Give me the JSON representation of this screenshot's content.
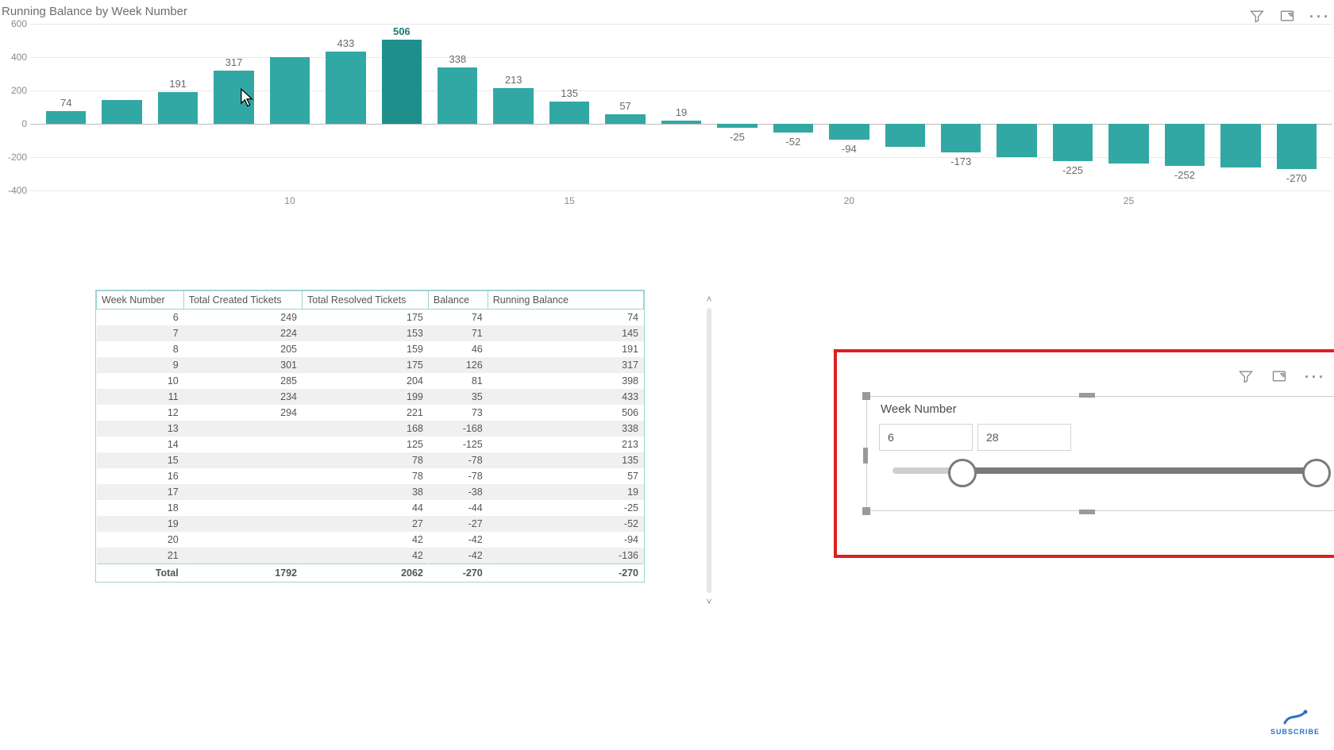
{
  "chart_data": {
    "type": "bar",
    "title": "Running Balance by Week Number",
    "xlabel": "",
    "ylabel": "",
    "ylim": [
      -400,
      600
    ],
    "y_ticks": [
      -400,
      -200,
      0,
      200,
      400,
      600
    ],
    "x_ticks": [
      10,
      15,
      20,
      25
    ],
    "highlight_index": 6,
    "categories": [
      6,
      7,
      8,
      9,
      10,
      11,
      12,
      13,
      14,
      15,
      16,
      17,
      18,
      19,
      20,
      21,
      22,
      23,
      24,
      25,
      26,
      27,
      28
    ],
    "values": [
      74,
      145,
      191,
      317,
      398,
      433,
      506,
      338,
      213,
      135,
      57,
      19,
      -25,
      -52,
      -94,
      -136,
      -173,
      -198,
      -225,
      -238,
      -252,
      -261,
      -270
    ],
    "data_labels": [
      74,
      null,
      191,
      317,
      null,
      433,
      506,
      338,
      213,
      135,
      57,
      19,
      -25,
      -52,
      -94,
      null,
      -173,
      null,
      -225,
      null,
      -252,
      null,
      -270
    ]
  },
  "table": {
    "headers": [
      "Week Number",
      "Total Created Tickets",
      "Total Resolved Tickets",
      "Balance",
      "Running Balance"
    ],
    "rows": [
      [
        6,
        249,
        175,
        74,
        74
      ],
      [
        7,
        224,
        153,
        71,
        145
      ],
      [
        8,
        205,
        159,
        46,
        191
      ],
      [
        9,
        301,
        175,
        126,
        317
      ],
      [
        10,
        285,
        204,
        81,
        398
      ],
      [
        11,
        234,
        199,
        35,
        433
      ],
      [
        12,
        294,
        221,
        73,
        506
      ],
      [
        13,
        null,
        168,
        -168,
        338
      ],
      [
        14,
        null,
        125,
        -125,
        213
      ],
      [
        15,
        null,
        78,
        -78,
        135
      ],
      [
        16,
        null,
        78,
        -78,
        57
      ],
      [
        17,
        null,
        38,
        -38,
        19
      ],
      [
        18,
        null,
        44,
        -44,
        -25
      ],
      [
        19,
        null,
        27,
        -27,
        -52
      ],
      [
        20,
        null,
        42,
        -42,
        -94
      ],
      [
        21,
        null,
        42,
        -42,
        -136
      ]
    ],
    "totals": [
      "Total",
      1792,
      2062,
      -270,
      -270
    ]
  },
  "slicer": {
    "title": "Week Number",
    "min": 6,
    "max": 28
  },
  "watermark": {
    "text": "SUBSCRIBE"
  }
}
